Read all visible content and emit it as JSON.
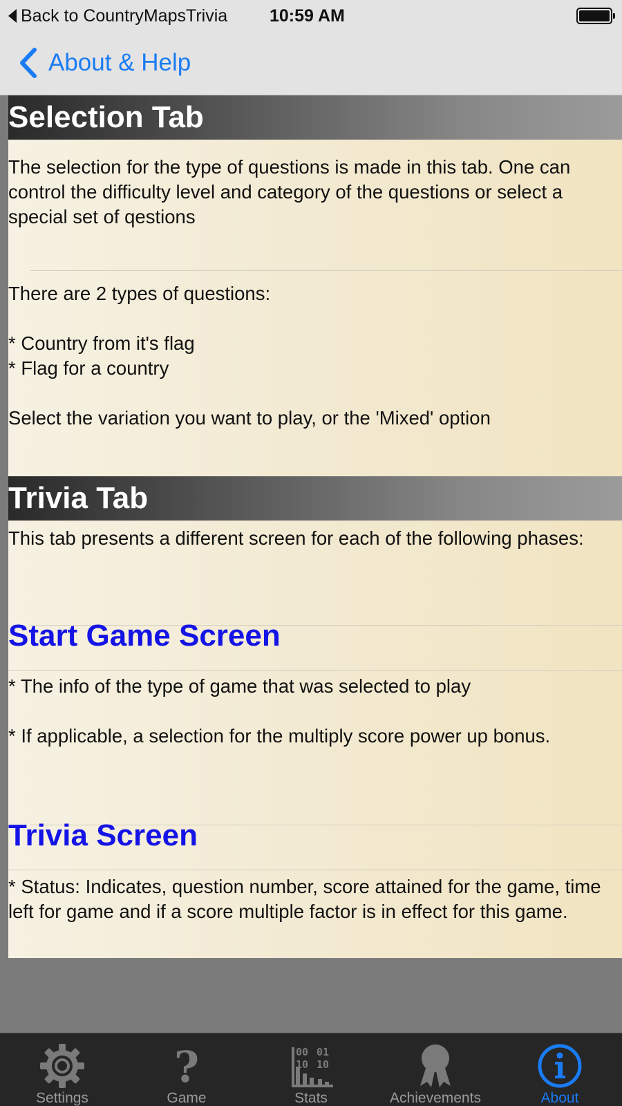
{
  "status_bar": {
    "back_app_label": "Back to CountryMapsTrivia",
    "time": "10:59 AM",
    "battery_icon": "battery-full-icon"
  },
  "nav": {
    "back_label": "About & Help",
    "back_icon": "chevron-left-icon",
    "accent_color": "#1a7cf4"
  },
  "content": {
    "selection_tab": {
      "title": "Selection Tab",
      "intro": "The selection for the type of questions is made in this tab. One can control the difficulty level and category of the questions or select a special set of qestions",
      "types_intro": "There are 2 types of questions:",
      "types": [
        " * Country from it's flag",
        " * Flag for a country"
      ],
      "instruction": "Select the variation you want to play, or the 'Mixed' option"
    },
    "trivia_tab": {
      "title": "Trivia Tab",
      "intro": "This tab presents a different screen for each of the following phases:",
      "start_game_screen": {
        "title": "Start Game Screen",
        "items": [
          " * The info of the type of game that was selected to play",
          " * If applicable, a selection for the multiply score power up bonus."
        ]
      },
      "trivia_screen": {
        "title": "Trivia Screen",
        "items": [
          " * Status: Indicates, question number, score attained for the game, time left for game and if a score multiple factor is in effect for this game."
        ]
      }
    },
    "heading_color": "#1414e6"
  },
  "tab_bar": {
    "items": [
      {
        "label": "Settings",
        "icon": "gear-icon",
        "active": false
      },
      {
        "label": "Game",
        "icon": "question-mark-icon",
        "active": false
      },
      {
        "label": "Stats",
        "icon": "stats-binary-icon",
        "active": false
      },
      {
        "label": "Achievements",
        "icon": "ribbon-award-icon",
        "active": false
      },
      {
        "label": "About",
        "icon": "info-icon",
        "active": true
      }
    ],
    "active_color": "#1a7cf4",
    "inactive_color": "#9a9a9a"
  }
}
